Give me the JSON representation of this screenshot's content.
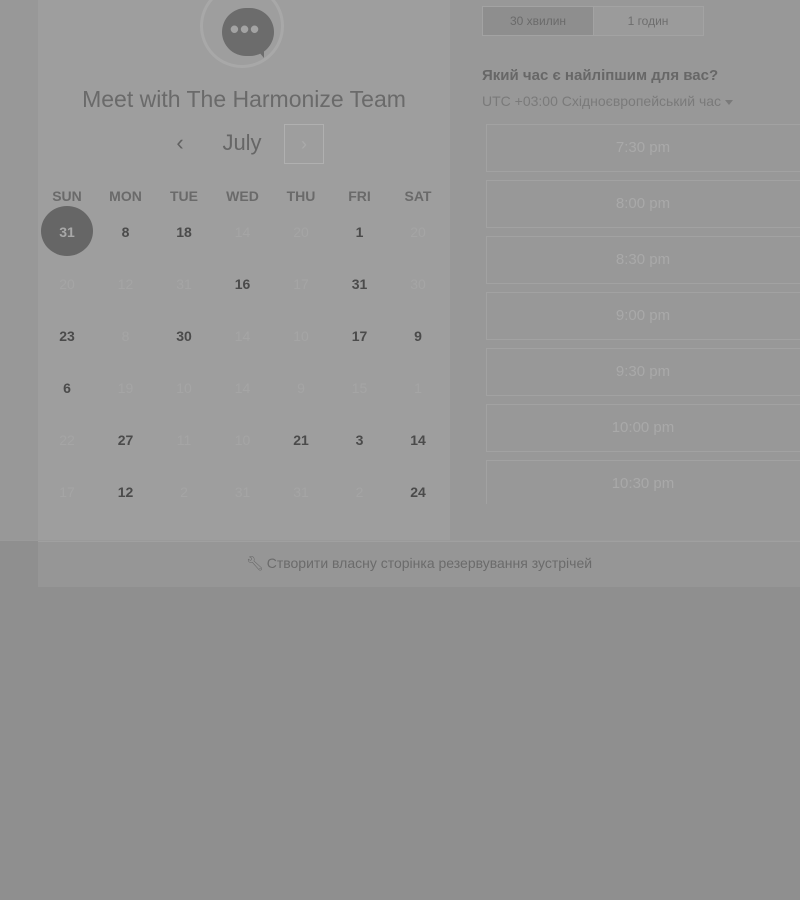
{
  "header": {
    "title": "Meet with The Harmonize Team",
    "logo_dots": "•••"
  },
  "calendar": {
    "month": "July",
    "prev_symbol": "‹",
    "next_symbol": "›",
    "weekdays": [
      "SUN",
      "MON",
      "TUE",
      "WED",
      "THU",
      "FRI",
      "SAT"
    ],
    "weeks": [
      [
        {
          "d": "31",
          "on": true,
          "sel": true
        },
        {
          "d": "8",
          "on": true
        },
        {
          "d": "18",
          "on": true
        },
        {
          "d": "14",
          "on": false
        },
        {
          "d": "20",
          "on": false
        },
        {
          "d": "1",
          "on": true
        },
        {
          "d": "20",
          "on": false
        }
      ],
      [
        {
          "d": "20",
          "on": false
        },
        {
          "d": "12",
          "on": false
        },
        {
          "d": "31",
          "on": false
        },
        {
          "d": "16",
          "on": true
        },
        {
          "d": "17",
          "on": false
        },
        {
          "d": "31",
          "on": true
        },
        {
          "d": "30",
          "on": false
        }
      ],
      [
        {
          "d": "23",
          "on": true
        },
        {
          "d": "8",
          "on": false
        },
        {
          "d": "30",
          "on": true
        },
        {
          "d": "14",
          "on": false
        },
        {
          "d": "10",
          "on": false
        },
        {
          "d": "17",
          "on": true
        },
        {
          "d": "9",
          "on": true
        }
      ],
      [
        {
          "d": "6",
          "on": true
        },
        {
          "d": "19",
          "on": false
        },
        {
          "d": "10",
          "on": false
        },
        {
          "d": "14",
          "on": false
        },
        {
          "d": "9",
          "on": false
        },
        {
          "d": "15",
          "on": false
        },
        {
          "d": "1",
          "on": false
        }
      ],
      [
        {
          "d": "22",
          "on": false
        },
        {
          "d": "27",
          "on": true
        },
        {
          "d": "11",
          "on": false
        },
        {
          "d": "10",
          "on": false
        },
        {
          "d": "21",
          "on": true
        },
        {
          "d": "3",
          "on": true
        },
        {
          "d": "14",
          "on": true
        }
      ],
      [
        {
          "d": "17",
          "on": false
        },
        {
          "d": "12",
          "on": true
        },
        {
          "d": "2",
          "on": false
        },
        {
          "d": "31",
          "on": false
        },
        {
          "d": "31",
          "on": false
        },
        {
          "d": "2",
          "on": false
        },
        {
          "d": "24",
          "on": true
        }
      ]
    ]
  },
  "booking": {
    "durations": [
      {
        "label": "30 хвилин",
        "active": true
      },
      {
        "label": "1 годин",
        "active": false
      }
    ],
    "question": "Який час є найліпшим для вас?",
    "timezone": "UTC +03:00 Східноєвропейський час",
    "slots": [
      "7:30 pm",
      "8:00 pm",
      "8:30 pm",
      "9:00 pm",
      "9:30 pm",
      "10:00 pm",
      "10:30 pm"
    ]
  },
  "footer": {
    "link_text": "Створити власну сторінка резервування зустрічей",
    "icon": "wrench-icon"
  }
}
